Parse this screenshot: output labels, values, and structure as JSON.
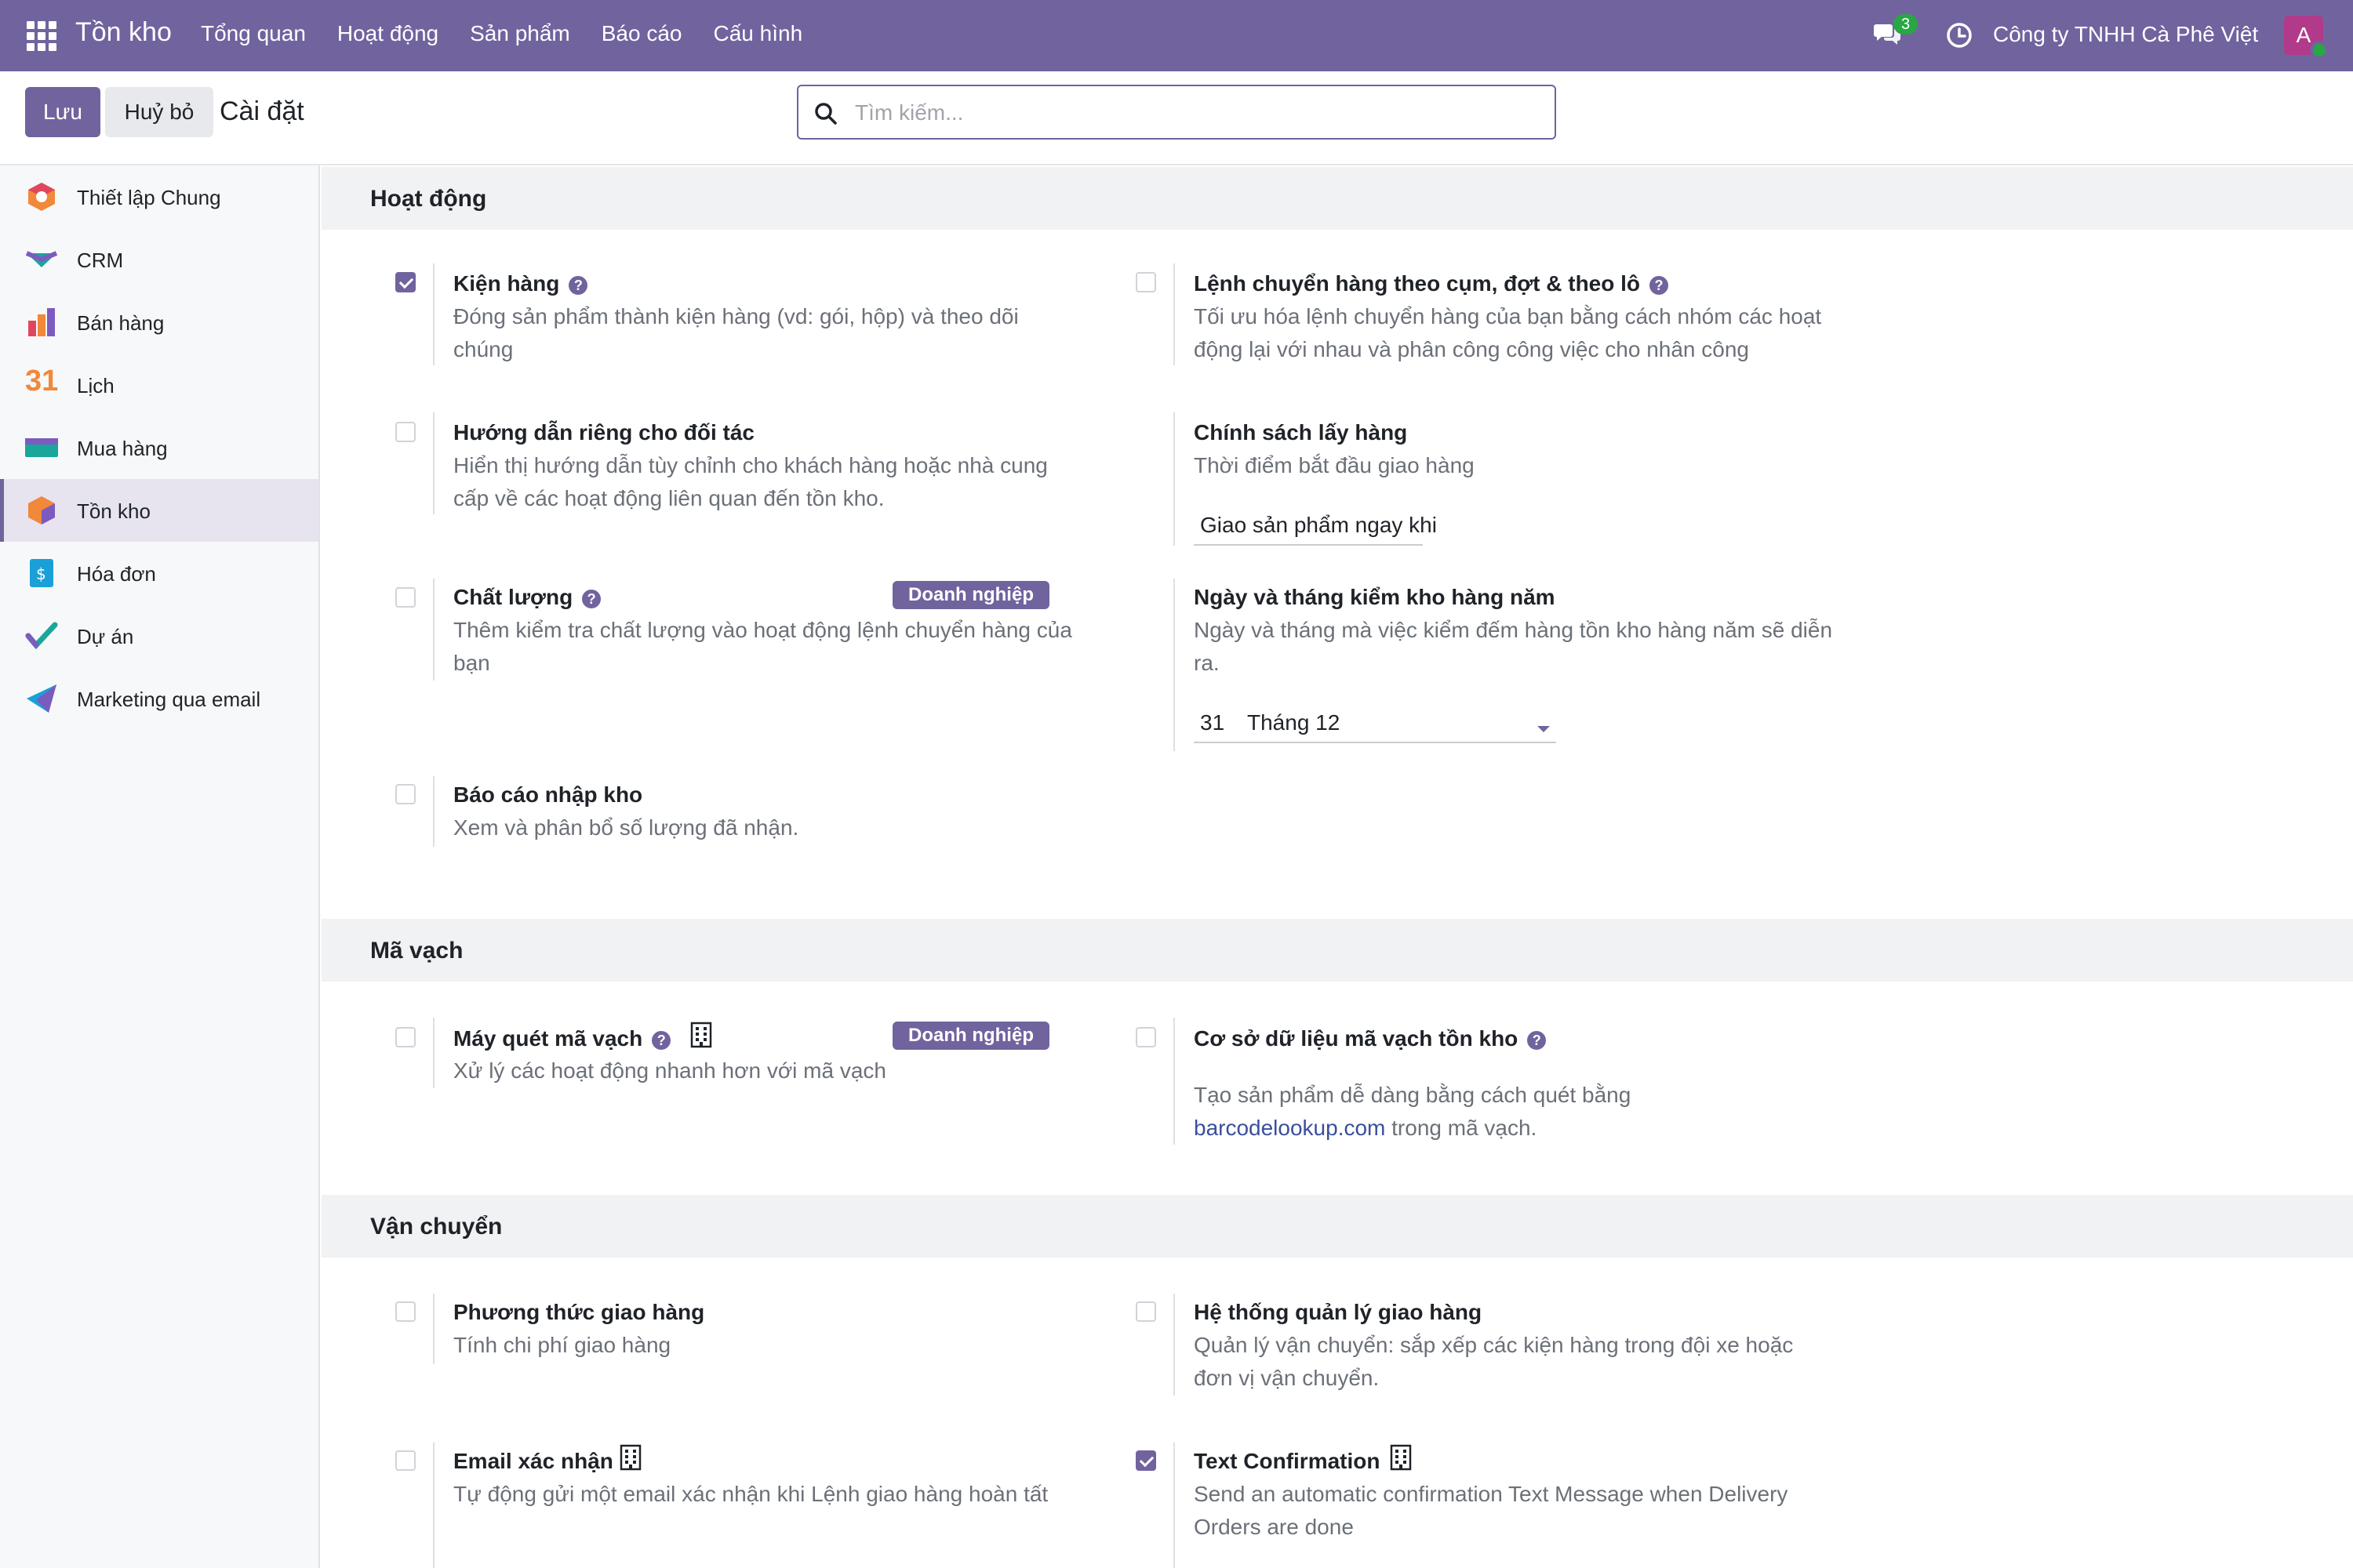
{
  "navbar": {
    "app_name": "Tồn kho",
    "menu": [
      "Tổng quan",
      "Hoạt động",
      "Sản phẩm",
      "Báo cáo",
      "Cấu hình"
    ],
    "chat_count": "3",
    "company": "Công ty TNHH Cà Phê Việt",
    "avatar_letter": "A"
  },
  "control": {
    "save_label": "Lưu",
    "cancel_label": "Huỷ bỏ",
    "title": "Cài đặt",
    "search_placeholder": "Tìm kiếm..."
  },
  "sidebar": {
    "items": [
      {
        "label": "Thiết lập Chung",
        "icon": "settings-app-icon"
      },
      {
        "label": "CRM",
        "icon": "crm-app-icon"
      },
      {
        "label": "Bán hàng",
        "icon": "sales-app-icon"
      },
      {
        "label": "Lịch",
        "icon": "calendar-app-icon"
      },
      {
        "label": "Mua hàng",
        "icon": "purchase-app-icon"
      },
      {
        "label": "Tồn kho",
        "icon": "inventory-app-icon",
        "active": true
      },
      {
        "label": "Hóa đơn",
        "icon": "invoicing-app-icon"
      },
      {
        "label": "Dự án",
        "icon": "project-app-icon"
      },
      {
        "label": "Marketing qua email",
        "icon": "email-marketing-app-icon"
      }
    ],
    "calendar_number": "31"
  },
  "sections": {
    "operations": {
      "title": "Hoạt động",
      "packages": {
        "title": "Kiện hàng",
        "desc": "Đóng sản phẩm thành kiện hàng (vd: gói, hộp) và theo dõi chúng",
        "checked": true
      },
      "batch": {
        "title": "Lệnh chuyển hàng theo cụm, đợt & theo lô",
        "desc": "Tối ưu hóa lệnh chuyển hàng của bạn bằng cách nhóm các hoạt động lại với nhau và phân công công việc cho nhân công",
        "checked": false
      },
      "partner_note": {
        "title": "Hướng dẫn riêng cho đối tác",
        "desc": "Hiển thị hướng dẫn tùy chỉnh cho khách hàng hoặc nhà cung cấp về các hoạt động liên quan đến tồn kho.",
        "checked": false
      },
      "picking_policy": {
        "title": "Chính sách lấy hàng",
        "desc": "Thời điểm bắt đầu giao hàng",
        "value": "Giao sản phẩm ngay khi"
      },
      "quality": {
        "title": "Chất lượng",
        "desc": "Thêm kiểm tra chất lượng vào hoạt động lệnh chuyển hàng của bạn",
        "badge": "Doanh nghiệp",
        "checked": false
      },
      "annual_inventory": {
        "title": "Ngày và tháng kiểm kho hàng năm",
        "desc": "Ngày và tháng mà việc kiểm đếm hàng tồn kho hàng năm sẽ diễn ra.",
        "day": "31",
        "month": "Tháng 12"
      },
      "reception_report": {
        "title": "Báo cáo nhập kho",
        "desc": "Xem và phân bổ số lượng đã nhận.",
        "checked": false
      }
    },
    "barcode": {
      "title": "Mã vạch",
      "scanner": {
        "title": "Máy quét mã vạch",
        "desc": "Xử lý các hoạt động nhanh hơn với mã vạch",
        "badge": "Doanh nghiệp",
        "checked": false
      },
      "database": {
        "title": "Cơ sở dữ liệu mã vạch tồn kho",
        "desc_before": "Tạo sản phẩm dễ dàng bằng cách quét bằng",
        "link": "barcodelookup.com",
        "desc_after": " trong mã vạch.",
        "checked": false
      }
    },
    "shipping": {
      "title": "Vận chuyển",
      "methods": {
        "title": "Phương thức giao hàng",
        "desc": "Tính chi phí giao hàng",
        "checked": false
      },
      "dispatch": {
        "title": "Hệ thống quản lý giao hàng",
        "desc": "Quản lý vận chuyển: sắp xếp các kiện hàng trong đội xe hoặc đơn vị vận chuyển.",
        "checked": false
      },
      "email_confirm": {
        "title": "Email xác nhận",
        "desc": "Tự động gửi một email xác nhận khi Lệnh giao hàng hoàn tất",
        "checked": false
      },
      "text_confirm": {
        "title": "Text Confirmation",
        "desc": "Send an automatic confirmation Text Message when Delivery Orders are done",
        "checked": true
      }
    }
  },
  "colors": {
    "brand": "#71639e",
    "section_bg": "#f1f2f4",
    "online": "#28a745"
  }
}
